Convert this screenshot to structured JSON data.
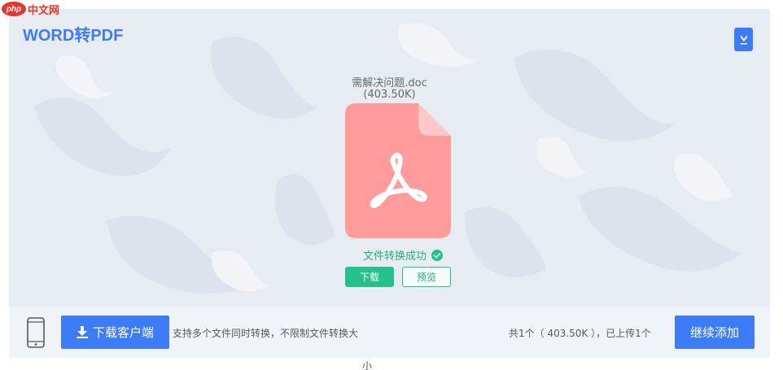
{
  "watermark": {
    "badge": "php",
    "site": "中文网"
  },
  "header": {
    "title": "WORD转PDF"
  },
  "file": {
    "name": "需解决问题.doc",
    "size": "(403.50K)",
    "status": "文件转换成功",
    "download_label": "下载",
    "preview_label": "预览"
  },
  "footer": {
    "client_button": "下载客户端",
    "description_line1": "支持多个文件同时转换，不限制文件转换大",
    "description_line2": "小",
    "summary": "共1个（ 403.50K ），已上传1个",
    "add_button": "继续添加"
  },
  "colors": {
    "accent": "#3d7cf6",
    "success": "#26c08a",
    "pdf_icon": "#ff9b9b",
    "panel_bg": "#e7ebf2"
  },
  "icons": [
    "pdf-file-icon",
    "check-circle-icon",
    "download-arrow-icon",
    "phone-icon",
    "corner-download-icon"
  ]
}
